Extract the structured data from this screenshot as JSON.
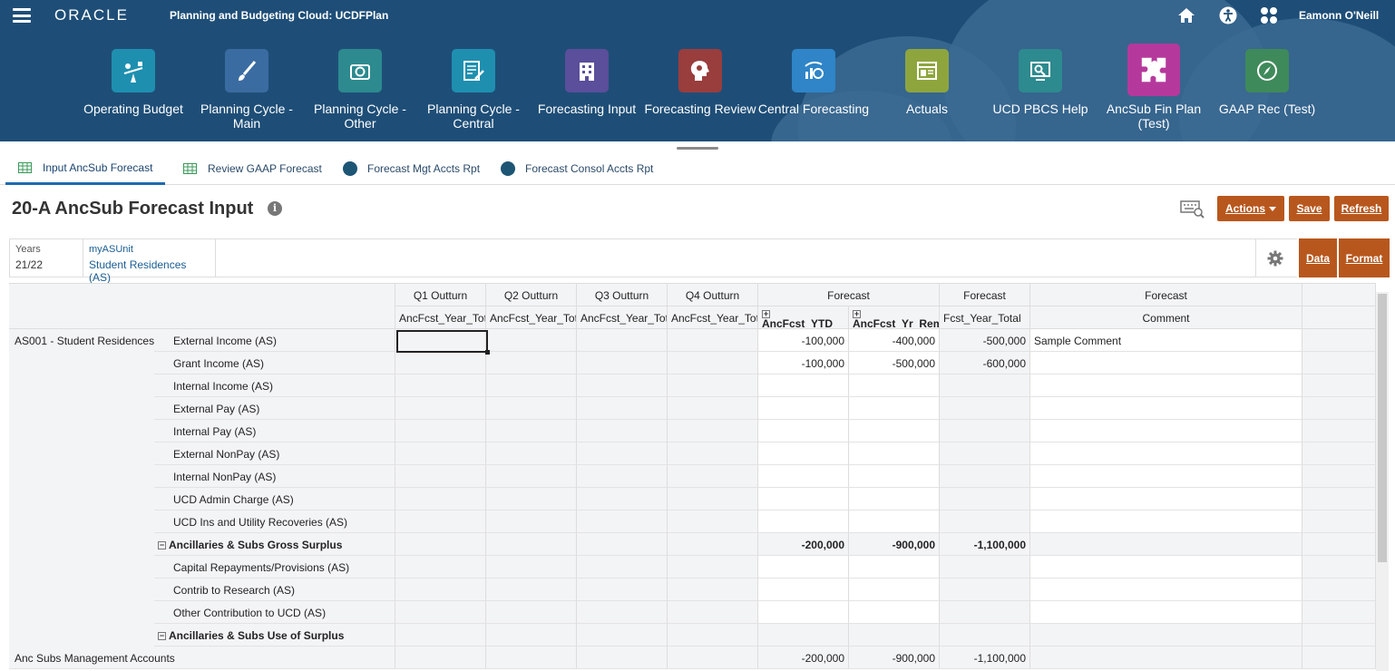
{
  "header": {
    "logo": "ORACLE",
    "app_title": "Planning and Budgeting Cloud: UCDFPlan",
    "user": "Eamonn O'Neill"
  },
  "cards": [
    {
      "label": "Operating Budget",
      "color": "#1f8fb0",
      "icon": "scale-icon"
    },
    {
      "label": "Planning Cycle - Main",
      "color": "#3a6ca1",
      "icon": "brush-icon"
    },
    {
      "label": "Planning Cycle - Other",
      "color": "#2d8a8f",
      "icon": "camera-icon"
    },
    {
      "label": "Planning Cycle - Central",
      "color": "#1f8fb0",
      "icon": "form-edit-icon"
    },
    {
      "label": "Forecasting Input",
      "color": "#5b4e9a",
      "icon": "building-icon"
    },
    {
      "label": "Forecasting Review",
      "color": "#9a3d3d",
      "icon": "head-gears-icon"
    },
    {
      "label": "Central Forecasting",
      "color": "#2f85c7",
      "icon": "chart-refresh-icon"
    },
    {
      "label": "Actuals",
      "color": "#8ea53e",
      "icon": "report-icon"
    },
    {
      "label": "UCD PBCS Help",
      "color": "#2d8a8f",
      "icon": "help-screen-icon"
    },
    {
      "label": "AncSub Fin Plan (Test)",
      "color": "#b5399c",
      "icon": "puzzle-icon"
    },
    {
      "label": "GAAP Rec (Test)",
      "color": "#3f8a5a",
      "icon": "compass-icon"
    }
  ],
  "tabs": [
    {
      "label": "Input AncSub Forecast",
      "icon": "form-grid-icon"
    },
    {
      "label": "Review GAAP Forecast",
      "icon": "form-grid-icon"
    },
    {
      "label": "Forecast Mgt Accts Rpt",
      "icon": "report-dot-icon"
    },
    {
      "label": "Forecast Consol Accts Rpt",
      "icon": "report-dot-icon"
    }
  ],
  "form": {
    "title": "20-A AncSub Forecast Input",
    "info": "i",
    "actions_label": "Actions",
    "save_label": "Save",
    "refresh_label": "Refresh",
    "data_tab": "Data",
    "format_tab": "Format"
  },
  "pov": [
    {
      "label": "Years",
      "value": "21/22"
    },
    {
      "label": "myASUnit",
      "value": "Student Residences (AS)"
    }
  ],
  "grid": {
    "col_headers_1": [
      "Q1 Outturn",
      "Q2 Outturn",
      "Q3 Outturn",
      "Q4 Outturn",
      "Forecast",
      "Forecast",
      "Forecast"
    ],
    "col_headers_2": [
      "AncFcst_Year_Total",
      "AncFcst_Year_Total",
      "AncFcst_Year_Total",
      "AncFcst_Year_Total",
      "AncFcst_YTD",
      "AncFcst_Yr_Remaining",
      "Fcst_Year_Total",
      "Comment"
    ],
    "entity": "AS001 - Student Residences",
    "rows": [
      {
        "label": "External Income (AS)",
        "ytd": "-100,000",
        "rem": "-400,000",
        "total": "-500,000",
        "comment": "Sample Comment"
      },
      {
        "label": "Grant Income (AS)",
        "ytd": "-100,000",
        "rem": "-500,000",
        "total": "-600,000",
        "comment": ""
      },
      {
        "label": "Internal Income (AS)",
        "ytd": "",
        "rem": "",
        "total": "",
        "comment": ""
      },
      {
        "label": "External Pay (AS)",
        "ytd": "",
        "rem": "",
        "total": "",
        "comment": ""
      },
      {
        "label": "Internal Pay (AS)",
        "ytd": "",
        "rem": "",
        "total": "",
        "comment": ""
      },
      {
        "label": "External NonPay (AS)",
        "ytd": "",
        "rem": "",
        "total": "",
        "comment": ""
      },
      {
        "label": "Internal NonPay (AS)",
        "ytd": "",
        "rem": "",
        "total": "",
        "comment": ""
      },
      {
        "label": "UCD Admin Charge (AS)",
        "ytd": "",
        "rem": "",
        "total": "",
        "comment": ""
      },
      {
        "label": "UCD Ins and Utility Recoveries (AS)",
        "ytd": "",
        "rem": "",
        "total": "",
        "comment": ""
      },
      {
        "label": "Ancillaries & Subs Gross Surplus",
        "ytd": "-200,000",
        "rem": "-900,000",
        "total": "-1,100,000",
        "comment": ""
      },
      {
        "label": "Capital Repayments/Provisions (AS)",
        "ytd": "",
        "rem": "",
        "total": "",
        "comment": ""
      },
      {
        "label": "Contrib to Research (AS)",
        "ytd": "",
        "rem": "",
        "total": "",
        "comment": ""
      },
      {
        "label": "Other Contribution to UCD (AS)",
        "ytd": "",
        "rem": "",
        "total": "",
        "comment": ""
      },
      {
        "label": "Ancillaries & Subs Use of Surplus",
        "ytd": "",
        "rem": "",
        "total": "",
        "comment": ""
      },
      {
        "label": "Anc Subs Management Accounts",
        "ytd": "-200,000",
        "rem": "-900,000",
        "total": "-1,100,000",
        "comment": ""
      }
    ]
  }
}
